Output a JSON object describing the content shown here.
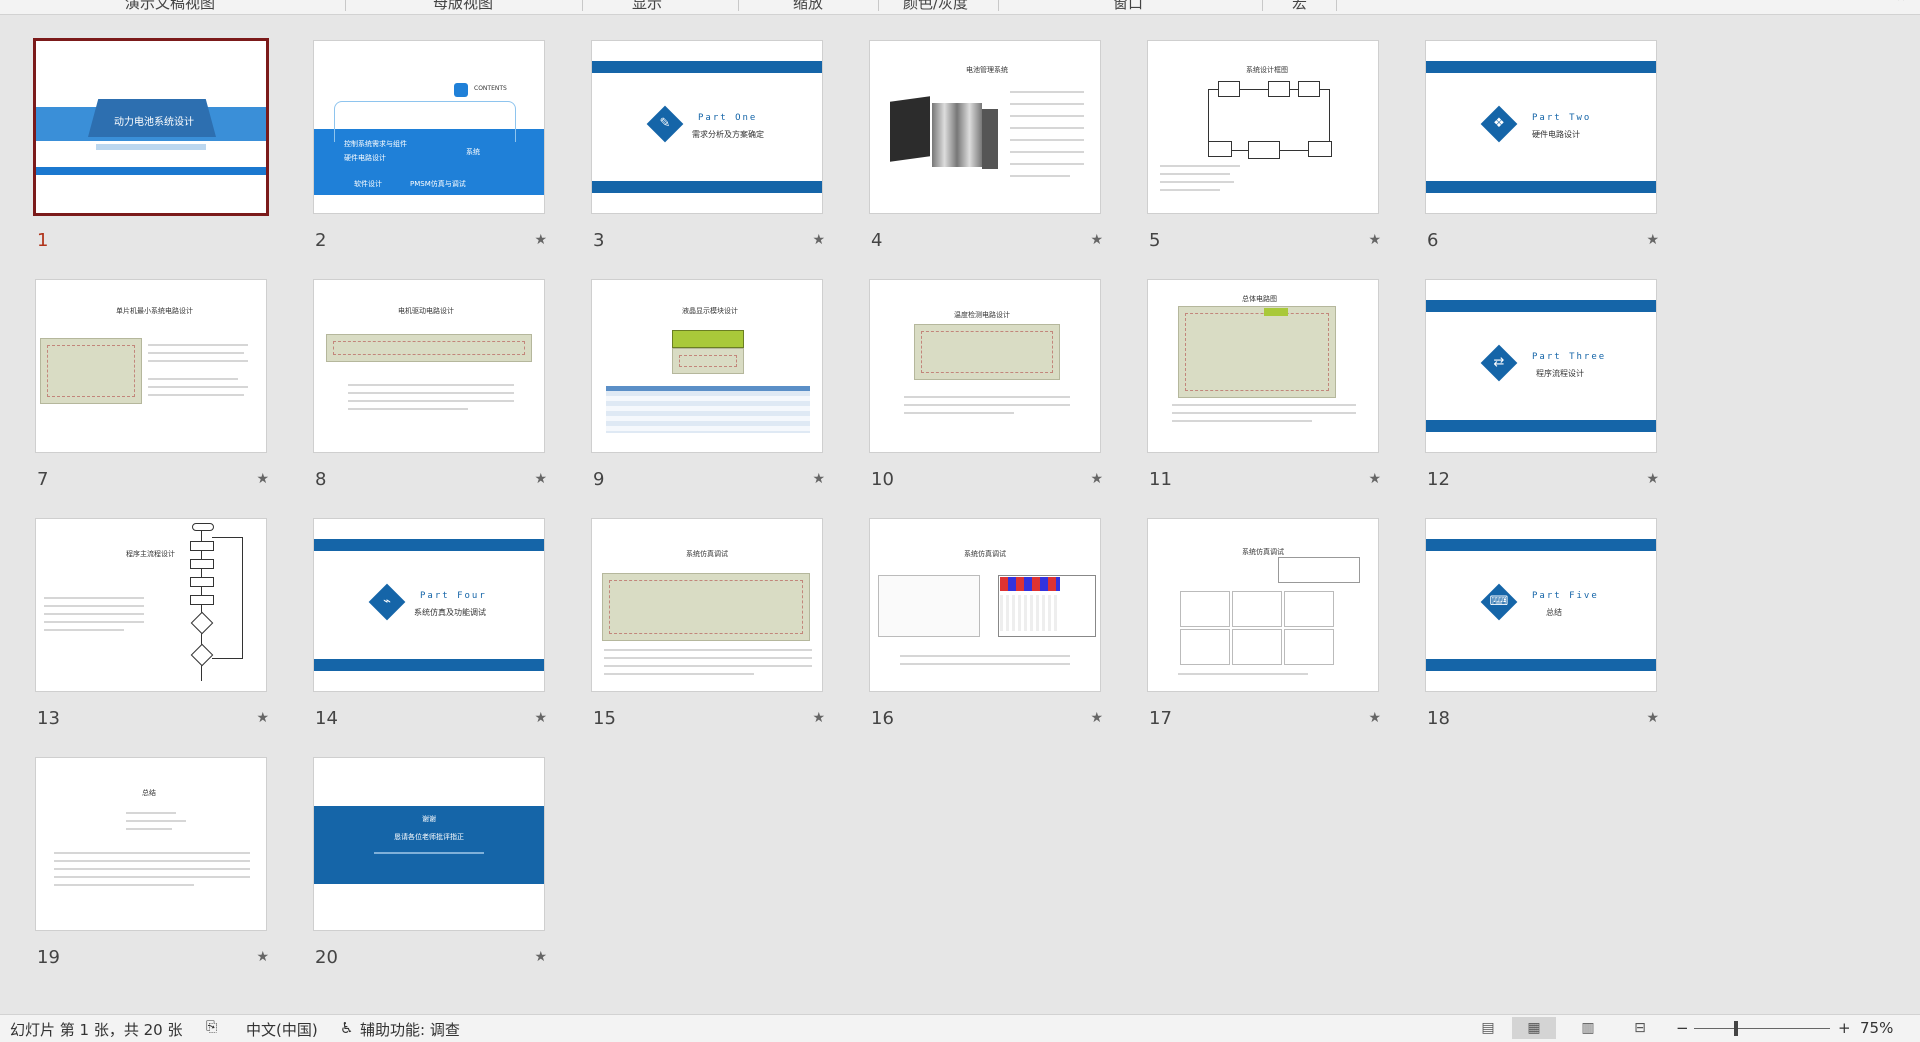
{
  "ribbon": {
    "groups": [
      "演示文稿视图",
      "母版视图",
      "显示",
      "缩放",
      "颜色/灰度",
      "窗口",
      "宏"
    ]
  },
  "slides": [
    {
      "number": "1",
      "title": "动力电池系统设计",
      "selected": true
    },
    {
      "number": "2",
      "title": "CONTENTS",
      "items": [
        "控制系统需求与组件",
        "硬件电路设计",
        "系统",
        "软件设计",
        "PMSM仿真与调试"
      ]
    },
    {
      "number": "3",
      "part": "Part One",
      "subtitle": "需求分析及方案确定"
    },
    {
      "number": "4",
      "title": "电池管理系统"
    },
    {
      "number": "5",
      "title": "系统设计框图"
    },
    {
      "number": "6",
      "part": "Part Two",
      "subtitle": "硬件电路设计"
    },
    {
      "number": "7",
      "title": "单片机最小系统电路设计"
    },
    {
      "number": "8",
      "title": "电机驱动电路设计"
    },
    {
      "number": "9",
      "title": "液晶显示模块设计"
    },
    {
      "number": "10",
      "title": "温度检测电路设计"
    },
    {
      "number": "11",
      "title": "总体电路图"
    },
    {
      "number": "12",
      "part": "Part Three",
      "subtitle": "程序流程设计"
    },
    {
      "number": "13",
      "title": "程序主流程设计"
    },
    {
      "number": "14",
      "part": "Part Four",
      "subtitle": "系统仿真及功能调试"
    },
    {
      "number": "15",
      "title": "系统仿真调试"
    },
    {
      "number": "16",
      "title": "系统仿真调试"
    },
    {
      "number": "17",
      "title": "系统仿真调试"
    },
    {
      "number": "18",
      "part": "Part Five",
      "subtitle": "总结"
    },
    {
      "number": "19",
      "title": "总结"
    },
    {
      "number": "20",
      "title": "谢谢",
      "subtitle": "恳请各位老师批评指正"
    }
  ],
  "star": "★",
  "statusbar": {
    "slide_info": "幻灯片 第 1 张，共 20 张",
    "language": "中文(中国)",
    "accessibility": "辅助功能: 调查",
    "zoom": "75%"
  }
}
